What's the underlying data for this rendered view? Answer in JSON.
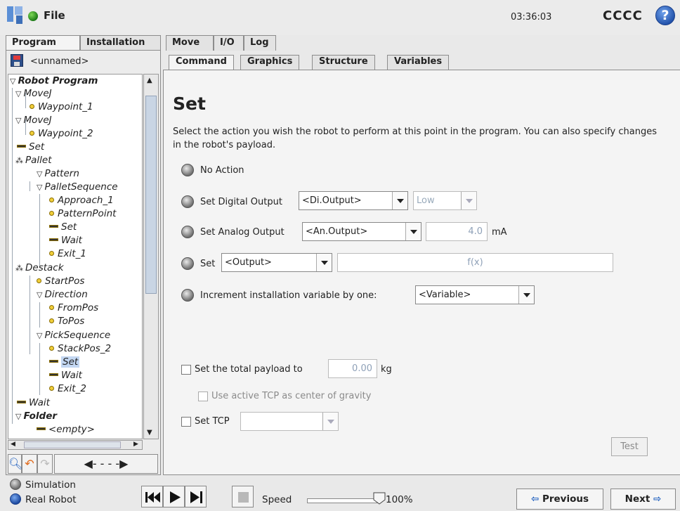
{
  "header": {
    "file_menu": "File",
    "clock": "03:36:03",
    "robot_name": "CCCC",
    "help": "?"
  },
  "main_tabs": [
    "Program",
    "Installation",
    "Move",
    "I/O",
    "Log"
  ],
  "left": {
    "program_name": "<unnamed>",
    "tree": [
      {
        "label": "Robot Program"
      },
      {
        "label": "MoveJ"
      },
      {
        "label": "Waypoint_1"
      },
      {
        "label": "MoveJ"
      },
      {
        "label": "Waypoint_2"
      },
      {
        "label": "Set"
      },
      {
        "label": "Pallet"
      },
      {
        "label": "Pattern"
      },
      {
        "label": "PalletSequence"
      },
      {
        "label": "Approach_1"
      },
      {
        "label": "PatternPoint"
      },
      {
        "label": "Set"
      },
      {
        "label": "Wait"
      },
      {
        "label": "Exit_1"
      },
      {
        "label": "Destack"
      },
      {
        "label": "StartPos"
      },
      {
        "label": "Direction"
      },
      {
        "label": "FromPos"
      },
      {
        "label": "ToPos"
      },
      {
        "label": "PickSequence"
      },
      {
        "label": "StackPos_2"
      },
      {
        "label": "Set"
      },
      {
        "label": "Wait"
      },
      {
        "label": "Exit_2"
      },
      {
        "label": "Wait"
      },
      {
        "label": "Folder"
      },
      {
        "label": "<empty>"
      }
    ]
  },
  "sub_tabs": [
    "Command",
    "Graphics",
    "Structure",
    "Variables"
  ],
  "content": {
    "title": "Set",
    "description": "Select the action you wish the robot to perform at this point in the program. You can also specify changes in the robot's payload.",
    "no_action": "No Action",
    "digital_output": {
      "label": "Set Digital Output",
      "select": "<Di.Output>",
      "level": "Low"
    },
    "analog_output": {
      "label": "Set Analog Output",
      "select": "<An.Output>",
      "value": "4.0",
      "unit": "mA"
    },
    "set_output": {
      "label": "Set",
      "select": "<Output>",
      "expression": "f(x)"
    },
    "increment": {
      "label": "Increment installation variable by one:",
      "select": "<Variable>"
    },
    "payload": {
      "label": "Set the total payload to",
      "value": "0.00",
      "unit": "kg"
    },
    "use_tcp": "Use active TCP as center of gravity",
    "set_tcp": "Set TCP",
    "test_button": "Test"
  },
  "footer": {
    "simulation": "Simulation",
    "real_robot": "Real Robot",
    "speed_label": "Speed",
    "speed_value": "100%",
    "previous": "Previous",
    "next": "Next"
  }
}
